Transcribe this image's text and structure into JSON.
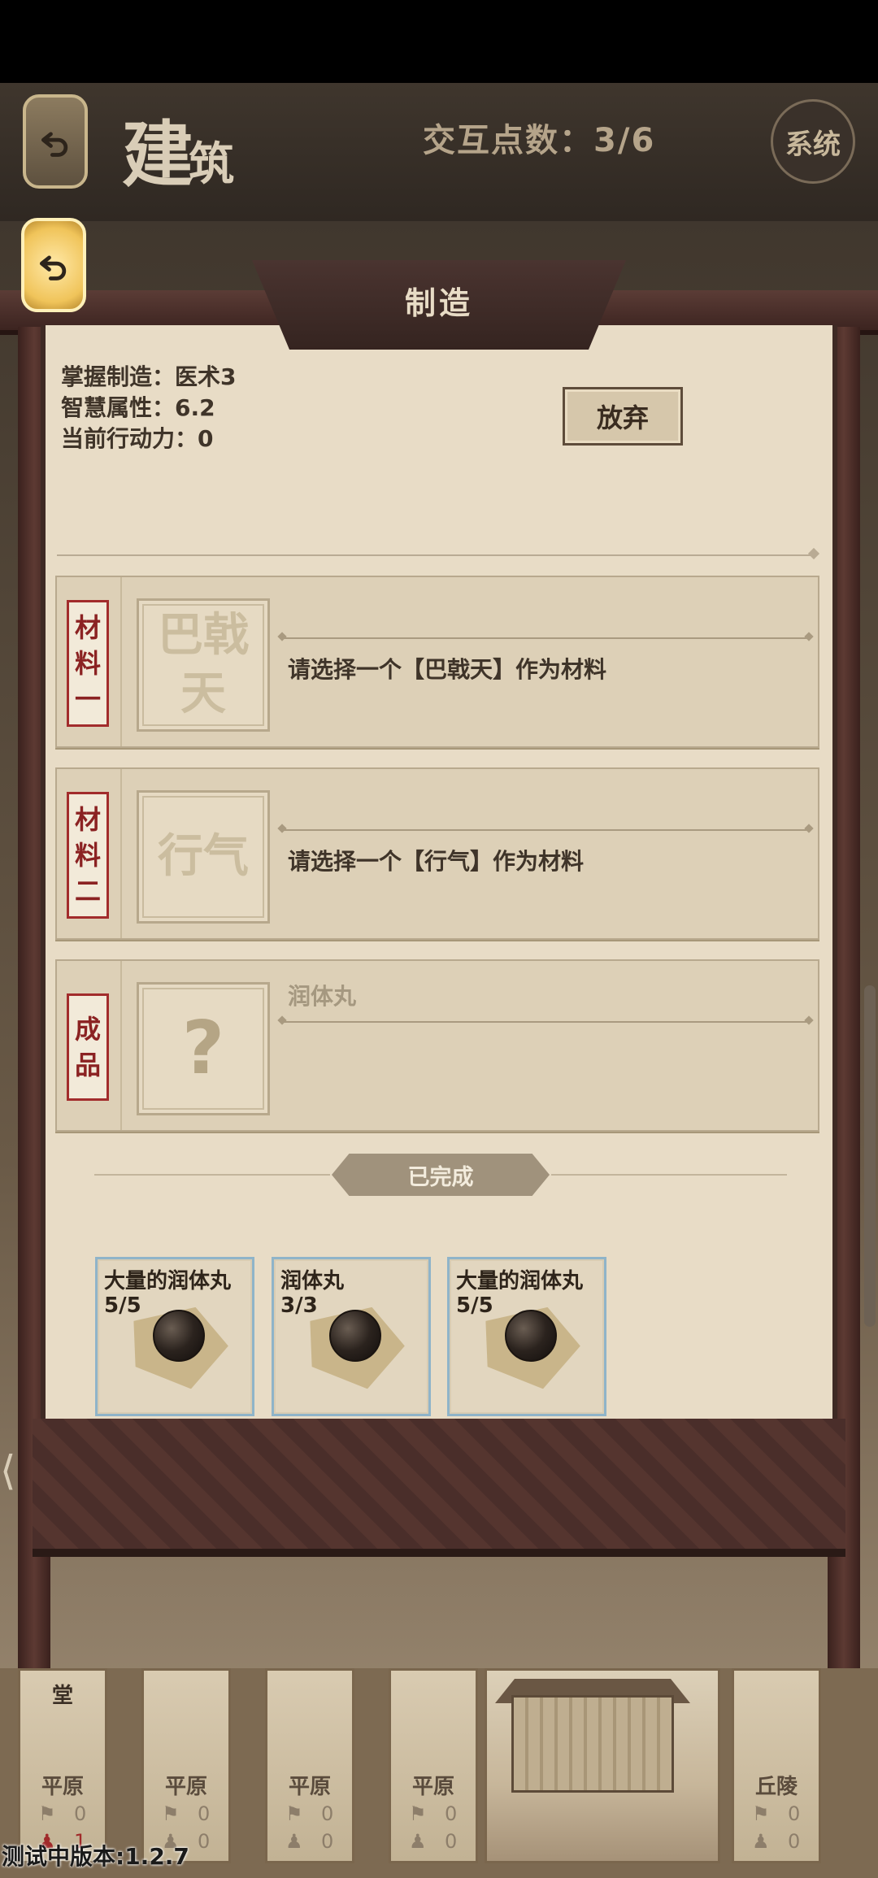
{
  "header": {
    "title_main": "建",
    "title_sub": "筑",
    "interaction_points": "交互点数：3/6",
    "system_label": "系统"
  },
  "panel": {
    "title": "制造",
    "info": {
      "skill": "掌握制造：医术3",
      "wisdom": "智慧属性：6.2",
      "action_power": "当前行动力：0"
    },
    "abandon_label": "放弃",
    "slots": [
      {
        "label": [
          "材",
          "料",
          "一"
        ],
        "box_text": "巴戟天",
        "name": "",
        "prompt": "请选择一个【巴戟天】作为材料"
      },
      {
        "label": [
          "材",
          "料",
          "二"
        ],
        "box_text": "行气",
        "name": "",
        "prompt": "请选择一个【行气】作为材料"
      },
      {
        "label": [
          "成",
          "品"
        ],
        "box_text": "?",
        "name": "润体丸",
        "prompt": ""
      }
    ],
    "completed_label": "已完成",
    "completed_items": [
      {
        "name": "大量的润体丸",
        "count": "5/5"
      },
      {
        "name": "润体丸",
        "count": "3/3"
      },
      {
        "name": "大量的润体丸",
        "count": "5/5"
      }
    ]
  },
  "tiles": [
    {
      "top": "堂",
      "terrain": "平原",
      "stat1": "0",
      "stat2": "1"
    },
    {
      "top": "",
      "terrain": "平原",
      "stat1": "0",
      "stat2": "0"
    },
    {
      "top": "",
      "terrain": "平原",
      "stat1": "0",
      "stat2": "0"
    },
    {
      "top": "",
      "terrain": "平原",
      "stat1": "0",
      "stat2": "0"
    },
    {
      "top": "",
      "terrain": "丘陵",
      "stat1": "0",
      "stat2": "0"
    }
  ],
  "version": "测试中版本:1.2.7",
  "colors": {
    "panel_bg": "#e8dcc6",
    "frame": "#3e2a24",
    "label_red": "#a22c2c",
    "card_border": "#8fb4c9"
  }
}
